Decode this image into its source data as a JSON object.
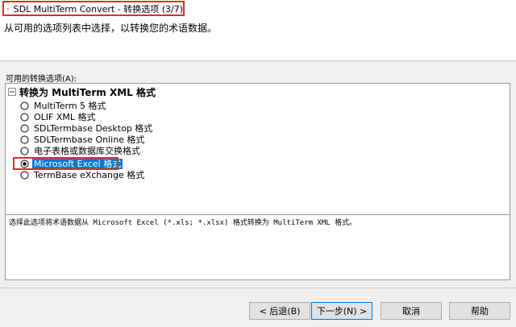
{
  "window": {
    "title": "SDL MultiTerm Convert - 转换选项 (3/7)"
  },
  "header": {
    "subtitle": "从可用的选项列表中选择，以转换您的术语数据。"
  },
  "options_group": {
    "label": "可用的转换选项(A):",
    "root_label": "转换为 MultiTerm XML 格式",
    "items": [
      {
        "label": "MultiTerm 5 格式",
        "selected": false
      },
      {
        "label": "OLIF XML 格式",
        "selected": false
      },
      {
        "label": "SDLTermbase Desktop 格式",
        "selected": false
      },
      {
        "label": "SDLTermbase Online 格式",
        "selected": false
      },
      {
        "label": "电子表格或数据库交换格式",
        "selected": false
      },
      {
        "label": "Microsoft Excel 格式",
        "selected": true
      },
      {
        "label": "TermBase eXchange 格式",
        "selected": false
      }
    ]
  },
  "description": {
    "text": "选择此选项将术语数据从 Microsoft Excel (*.xls; *.xlsx) 格式转换为 MultiTerm XML 格式。"
  },
  "buttons": {
    "back": "< 后退(B)",
    "next": "下一步(N) >",
    "cancel": "取消",
    "help": "帮助"
  },
  "colors": {
    "accent": "#0078d7",
    "highlight_box": "#d9302b"
  }
}
